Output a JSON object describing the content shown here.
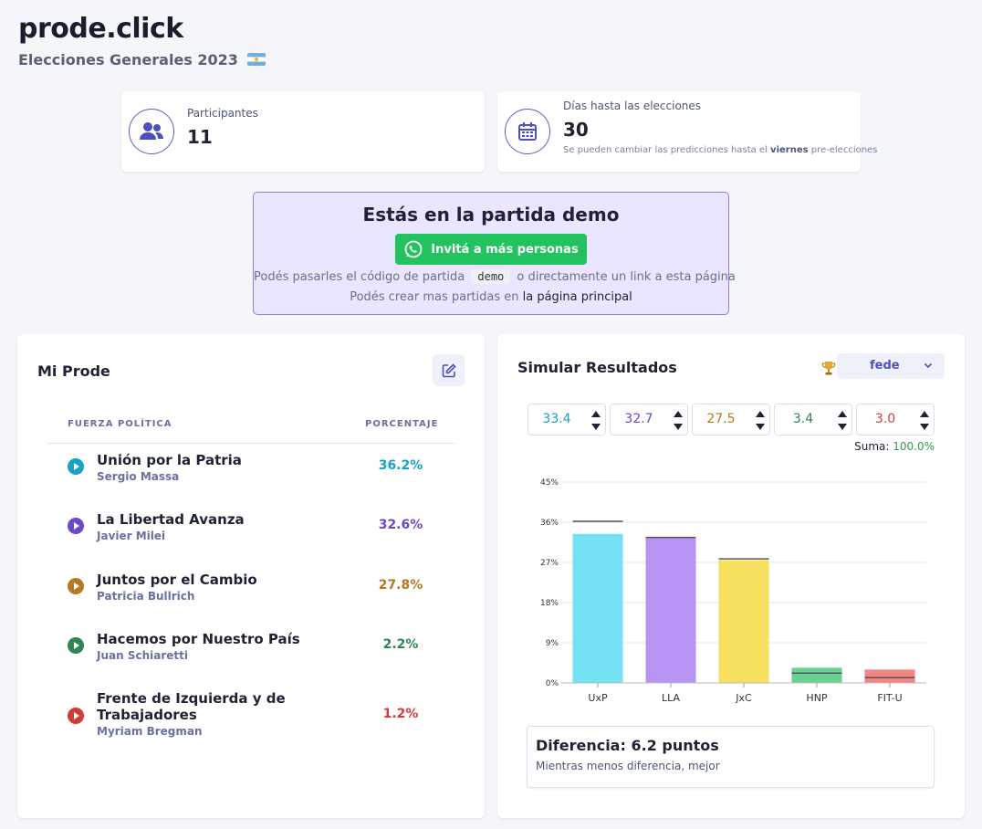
{
  "site": {
    "title": "prode.click",
    "subtitle": "Elecciones Generales 2023"
  },
  "stats": {
    "participants": {
      "label": "Participantes",
      "value": "11",
      "icon": "users-icon"
    },
    "days": {
      "label": "Días hasta las elecciones",
      "value": "30",
      "note_before": "Se pueden cambiar las predicciones hasta el ",
      "note_bold": "viernes",
      "note_after": " pre-elecciones",
      "icon": "calendar-icon"
    }
  },
  "demo": {
    "title": "Estás en la partida demo",
    "invite_label": "Invitá a más personas",
    "line1_before": "Podés pasarles el código de partida",
    "code": "demo",
    "line1_after": "o directamente un link a esta página",
    "line2_before": "Podés crear mas partidas en ",
    "line2_link": "la página principal"
  },
  "mi_prode": {
    "title": "Mi Prode",
    "col_party": "FUERZA POLÍTICA",
    "col_pct": "PORCENTAJE",
    "rows": [
      {
        "party": "Unión por la Patria",
        "candidate": "Sergio Massa",
        "pct": "36.2%",
        "color": "#16a2c0"
      },
      {
        "party": "La Libertad Avanza",
        "candidate": "Javier Milei",
        "pct": "32.6%",
        "color": "#6b48c6"
      },
      {
        "party": "Juntos por el Cambio",
        "candidate": "Patricia Bullrich",
        "pct": "27.8%",
        "color": "#b7791f"
      },
      {
        "party": "Hacemos por Nuestro País",
        "candidate": "Juan Schiaretti",
        "pct": "2.2%",
        "color": "#2f8556"
      },
      {
        "party": "Frente de Izquierda y de Trabajadores",
        "candidate": "Myriam Bregman",
        "pct": "1.2%",
        "color": "#d03c3c"
      }
    ]
  },
  "simular": {
    "title": "Simular Resultados",
    "user": "fede",
    "inputs": [
      {
        "value": "33.4",
        "color": "#16a2c0"
      },
      {
        "value": "32.7",
        "color": "#6b48c6"
      },
      {
        "value": "27.5",
        "color": "#b7791f"
      },
      {
        "value": "3.4",
        "color": "#2f8556"
      },
      {
        "value": "3.0",
        "color": "#d03c3c"
      }
    ],
    "suma_label": "Suma:",
    "suma_value": "100.0%",
    "diff_title": "Diferencia: 6.2 puntos",
    "diff_sub": "Mientras menos diferencia, mejor"
  },
  "chart_data": {
    "type": "bar",
    "categories": [
      "UxP",
      "LLA",
      "JxC",
      "HNP",
      "FIT-U"
    ],
    "values": [
      33.4,
      32.7,
      27.5,
      3.4,
      3.0
    ],
    "reference_values": [
      36.2,
      32.6,
      27.8,
      2.2,
      1.2
    ],
    "colors": [
      "#74e2f4",
      "#b794f4",
      "#f6e05e",
      "#68d391",
      "#f38585"
    ],
    "y_ticks": [
      "0%",
      "9%",
      "18%",
      "27%",
      "36%",
      "45%"
    ],
    "ylim": [
      0,
      45
    ],
    "grid": true
  }
}
